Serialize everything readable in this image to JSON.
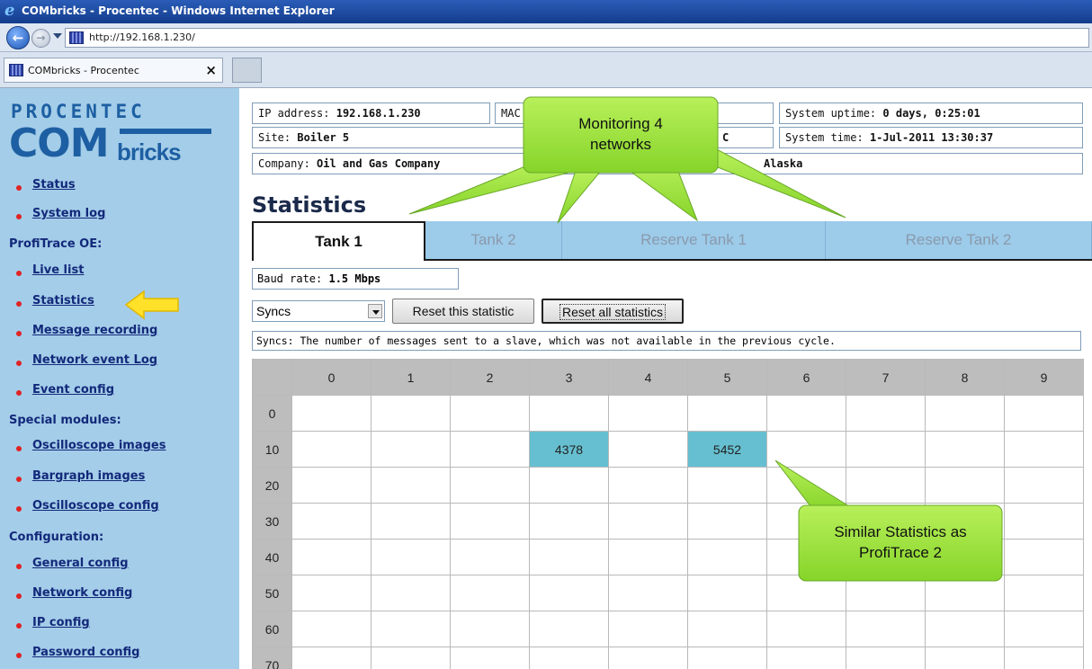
{
  "browser": {
    "window_title": "COMbricks - Procentec - Windows Internet Explorer",
    "url": "http://192.168.1.230/",
    "tab_label": "COMbricks - Procentec",
    "tab_close": "×",
    "back_glyph": "←",
    "forward_glyph": "→"
  },
  "logo": {
    "top": "PROCENTEC",
    "com": "COM",
    "bricks": "bricks"
  },
  "sidebar": {
    "top_links": [
      "Status",
      "System log"
    ],
    "sections": [
      {
        "header": "ProfiTrace OE:",
        "items": [
          "Live list",
          "Statistics",
          "Message recording",
          "Network event Log",
          "Event config"
        ]
      },
      {
        "header": "Special modules:",
        "items": [
          "Oscilloscope images",
          "Bargraph images",
          "Oscilloscope config"
        ]
      },
      {
        "header": "Configuration:",
        "items": [
          "General config",
          "Network config",
          "IP config",
          "Password config"
        ]
      }
    ]
  },
  "info": {
    "ip_label": "IP address:",
    "ip_value": "192.168.1.230",
    "mac_label": "MAC",
    "uptime_label": "System uptime:",
    "uptime_value": "0 days, 0:25:01",
    "site_label": "Site:",
    "site_value": "Boiler 5",
    "c_value": "C",
    "time_label": "System time:",
    "time_value": "1-Jul-2011 13:30:37",
    "company_label": "Company:",
    "company_value": "Oil and Gas Company",
    "country_value": "Alaska"
  },
  "page": {
    "heading": "Statistics",
    "tabs": [
      "Tank 1",
      "Tank 2",
      "Reserve Tank 1",
      "Reserve Tank 2"
    ],
    "baud_label": "Baud rate:",
    "baud_value": "1.5 Mbps",
    "select_value": "Syncs",
    "reset_this": "Reset this statistic",
    "reset_all": "Reset all statistics",
    "description": "Syncs: The number of messages sent to a slave, which was not available in the previous cycle."
  },
  "grid": {
    "columns": [
      "0",
      "1",
      "2",
      "3",
      "4",
      "5",
      "6",
      "7",
      "8",
      "9"
    ],
    "rows": [
      "0",
      "10",
      "20",
      "30",
      "40",
      "50",
      "60",
      "70"
    ],
    "values": [
      [
        "",
        "",
        "",
        "",
        "",
        "",
        "",
        "",
        "",
        ""
      ],
      [
        "",
        "",
        "",
        "4378",
        "",
        "5452",
        "",
        "",
        "",
        ""
      ],
      [
        "",
        "",
        "",
        "",
        "",
        "",
        "",
        "",
        "",
        ""
      ],
      [
        "",
        "",
        "",
        "",
        "",
        "",
        "",
        "",
        "",
        ""
      ],
      [
        "",
        "",
        "",
        "",
        "",
        "",
        "",
        "",
        "",
        ""
      ],
      [
        "",
        "",
        "",
        "",
        "",
        "",
        "",
        "",
        "",
        ""
      ],
      [
        "",
        "",
        "",
        "",
        "",
        "",
        "",
        "",
        "",
        ""
      ],
      [
        "",
        "",
        "",
        "",
        "",
        "",
        "",
        "",
        "",
        ""
      ]
    ],
    "highlight_color": "#66bfd0"
  },
  "callouts": {
    "monitoring": "Monitoring 4 networks",
    "similar": "Similar Statistics as ProfiTrace 2",
    "color": "#9be13c"
  }
}
